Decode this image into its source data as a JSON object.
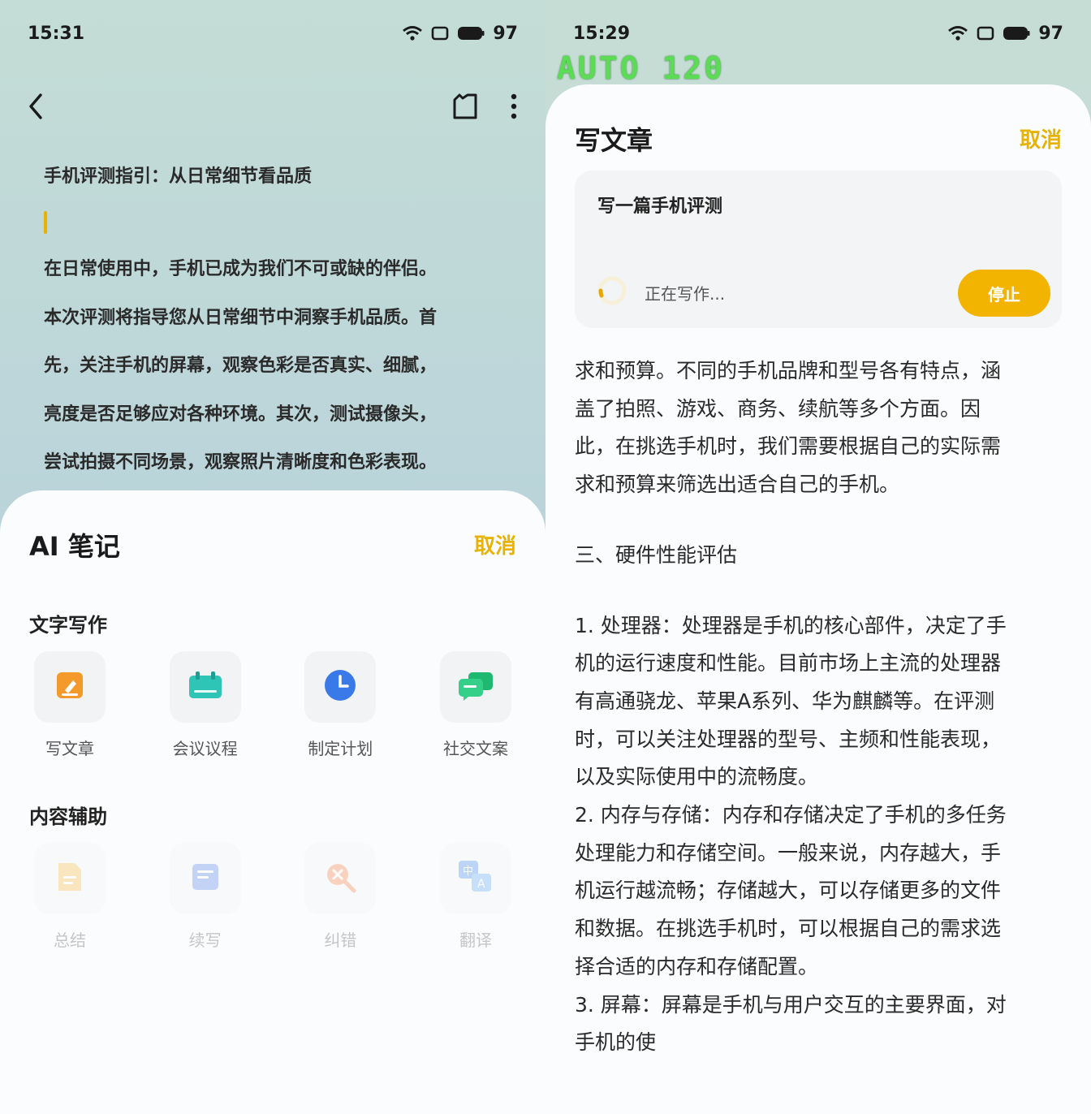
{
  "left": {
    "status": {
      "time": "15:31",
      "battery": "97"
    },
    "note": {
      "title": "手机评测指引：从日常细节看品质",
      "lines": [
        "在日常使用中，手机已成为我们不可或缺的伴侣。",
        "本次评测将指导您从日常细节中洞察手机品质。首",
        "先，关注手机的屏幕，观察色彩是否真实、细腻，",
        "亮度是否足够应对各种环境。其次，测试摄像头，",
        "尝试拍摄不同场景，观察照片清晰度和色彩表现。"
      ]
    },
    "sheet": {
      "title": "AI 笔记",
      "cancel": "取消",
      "section1": "文字写作",
      "tools1": [
        "写文章",
        "会议议程",
        "制定计划",
        "社交文案"
      ],
      "section2": "内容辅助",
      "tools2": [
        "总结",
        "续写",
        "纠错",
        "翻译"
      ]
    }
  },
  "right": {
    "status": {
      "time": "15:29",
      "battery": "97"
    },
    "badge": "AUTO 120",
    "sheet": {
      "title": "写文章",
      "cancel": "取消",
      "prompt": "写一篇手机评测",
      "writing": "正在写作...",
      "stop": "停止"
    },
    "article": {
      "p1": [
        "求和预算。不同的手机品牌和型号各有特点，涵",
        "盖了拍照、游戏、商务、续航等多个方面。因",
        "此，在挑选手机时，我们需要根据自己的实际需",
        "求和预算来筛选出适合自己的手机。"
      ],
      "heading": "三、硬件性能评估",
      "p2": [
        "1. 处理器：处理器是手机的核心部件，决定了手",
        "机的运行速度和性能。目前市场上主流的处理器",
        "有高通骁龙、苹果A系列、华为麒麟等。在评测",
        "时，可以关注处理器的型号、主频和性能表现，",
        "以及实际使用中的流畅度。",
        "2. 内存与存储：内存和存储决定了手机的多任务",
        "处理能力和存储空间。一般来说，内存越大，手",
        "机运行越流畅；存储越大，可以存储更多的文件",
        "和数据。在挑选手机时，可以根据自己的需求选",
        "择合适的内存和存储配置。",
        "3. 屏幕：屏幕是手机与用户交互的主要界面，对",
        "手机的使"
      ]
    }
  }
}
